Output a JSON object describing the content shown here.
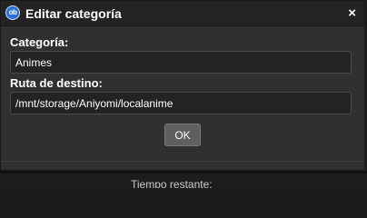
{
  "dialog": {
    "title": "Editar categoría",
    "app_icon_text": "ob",
    "close_glyph": "×"
  },
  "form": {
    "category_label": "Categoría:",
    "category_value": "Animes",
    "path_label": "Ruta de destino:",
    "path_value": "/mnt/storage/Aniyomi/localanime",
    "ok_label": "OK"
  },
  "background": {
    "partial_text": "Tiempo restante:"
  },
  "colors": {
    "dialog_bg": "#303030",
    "titlebar_bg": "#232323",
    "input_bg": "#232323",
    "button_bg": "#5f5f5f",
    "app_icon": "#2b6fd6"
  }
}
